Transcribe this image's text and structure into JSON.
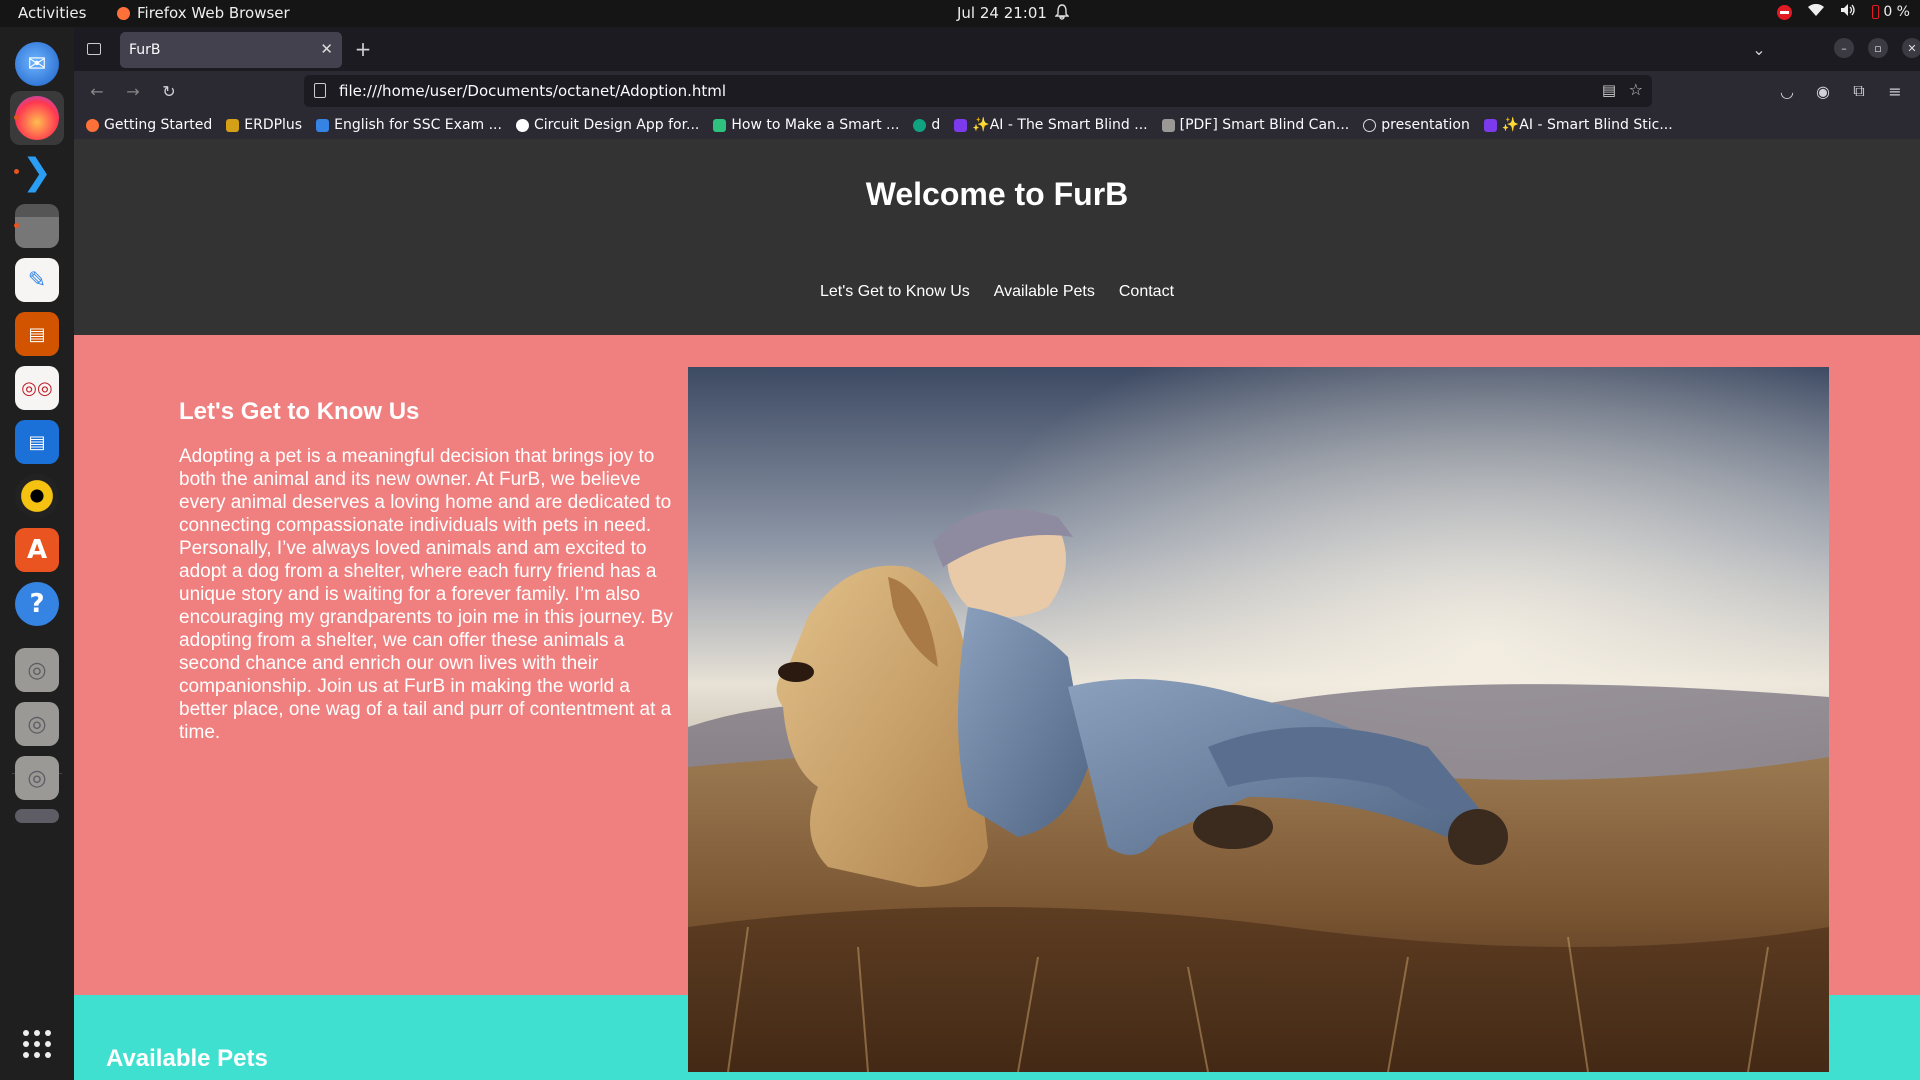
{
  "system": {
    "activities": "Activities",
    "app_name": "Firefox Web Browser",
    "clock": "Jul 24  21:01",
    "battery": "0 %"
  },
  "browser": {
    "tab_title": "FurB",
    "url": "file:///home/user/Documents/octanet/Adoption.html",
    "bookmarks": [
      "Getting Started",
      "ERDPlus",
      "English for SSC Exam ...",
      "Circuit Design App for...",
      "How to Make a Smart ...",
      "d",
      "✨AI - The Smart Blind ...",
      "[PDF] Smart Blind Can...",
      "presentation",
      "✨AI - Smart Blind Stic..."
    ]
  },
  "site": {
    "title": "Welcome to FurB",
    "nav": [
      "Let's Get to Know Us",
      "Available Pets",
      "Contact"
    ],
    "about": {
      "heading": "Let's Get to Know Us",
      "text": "Adopting a pet is a meaningful decision that brings joy to both the animal and its new owner. At FurB, we believe every animal deserves a loving home and are dedicated to connecting compassionate individuals with pets in need. Personally, I’ve always loved animals and am excited to adopt a dog from a shelter, where each furry friend has a unique story and is waiting for a forever family. I’m also encouraging my grandparents to join me in this journey. By adopting from a shelter, we can offer these animals a second chance and enrich our own lives with their companionship. Join us at FurB in making the world a better place, one wag of a tail and purr of contentment at a time."
    },
    "pets": {
      "heading": "Available Pets"
    }
  },
  "colors": {
    "header_bg": "#333333",
    "about_bg": "#f08080",
    "pets_bg": "#40e0d0"
  },
  "dock_icons": [
    "thunderbird-icon",
    "firefox-icon",
    "vscode-icon",
    "files-icon",
    "text-editor-icon",
    "impress-icon",
    "document-viewer-icon",
    "writer-icon",
    "rhythmbox-icon",
    "app-center-icon",
    "help-icon",
    "disc-drive-icon",
    "disc-drive-icon",
    "disc-drive-icon",
    "drive-icon",
    "show-apps-icon"
  ]
}
